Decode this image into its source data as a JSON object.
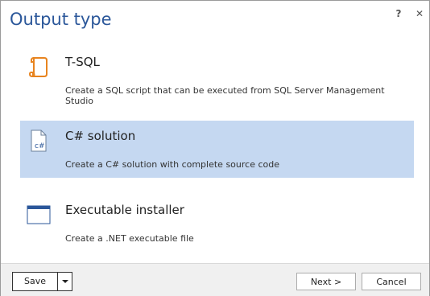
{
  "dialog": {
    "title": "Output type",
    "help_label": "?",
    "close_label": "✕"
  },
  "options": [
    {
      "title": "T-SQL",
      "description": "Create a SQL script that can be executed from SQL Server Management Studio",
      "icon": "scroll-icon",
      "selected": false
    },
    {
      "title": "C# solution",
      "description": "Create a C# solution with complete source code",
      "icon": "csharp-file-icon",
      "icon_text": "c#",
      "selected": true
    },
    {
      "title": "Executable installer",
      "description": "Create a .NET executable file",
      "icon": "window-icon",
      "selected": false
    }
  ],
  "footer": {
    "save_label": "Save",
    "next_label": "Next >",
    "cancel_label": "Cancel"
  },
  "colors": {
    "title": "#2b579a",
    "selection": "#c5d8f1",
    "tsql_icon": "#e8841f",
    "window_icon": "#2b579a"
  }
}
